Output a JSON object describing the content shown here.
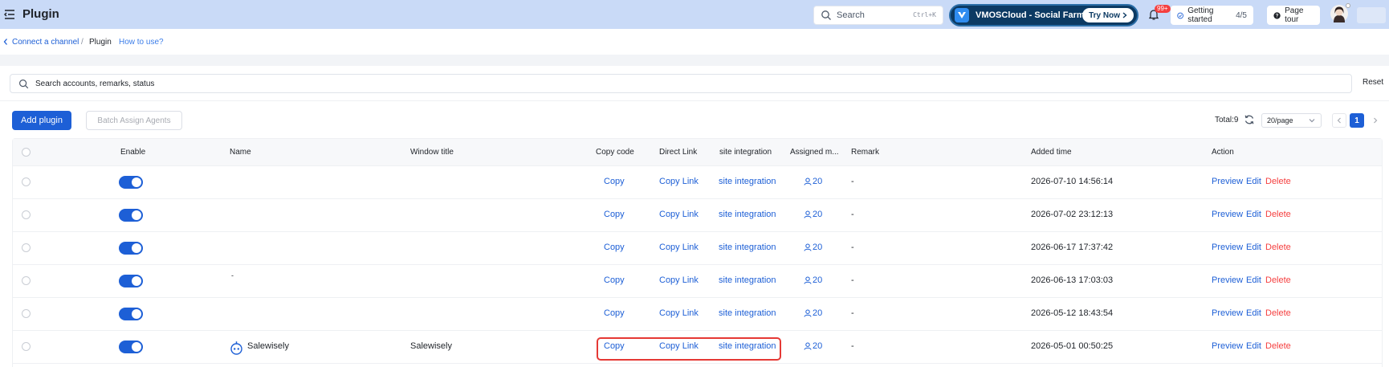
{
  "header": {
    "title": "Plugin",
    "search_placeholder": "Search",
    "search_shortcut": "Ctrl+K",
    "promo_text": "VMOSCloud - Social Farming",
    "promo_button": "Try Now",
    "notification_count": "99+",
    "getting_started_label": "Getting started",
    "getting_started_progress": "4/5",
    "page_tour_label": "Page tour"
  },
  "breadcrumb": {
    "back": "Connect a channel",
    "separator": "/",
    "current": "Plugin",
    "help": "How to use?"
  },
  "filter": {
    "placeholder": "Search accounts, remarks, status",
    "reset_label": "Reset"
  },
  "toolbar": {
    "add_label": "Add plugin",
    "batch_label": "Batch Assign Agents",
    "total_label": "Total:9",
    "page_size": "20/page",
    "current_page": "1"
  },
  "table": {
    "headers": {
      "enable": "Enable",
      "name": "Name",
      "window_title": "Window title",
      "copy_code": "Copy code",
      "direct_link": "Direct Link",
      "site_integration": "site integration",
      "assigned": "Assigned m...",
      "remark": "Remark",
      "added_time": "Added time",
      "action": "Action"
    },
    "rows": [
      {
        "name": "",
        "window_title": "",
        "copy": "Copy",
        "link": "Copy Link",
        "site": "site integration",
        "agents": "20",
        "remark": "-",
        "time": "2026-07-10 14:56:14",
        "preview": "Preview",
        "edit": "Edit",
        "delete": "Delete"
      },
      {
        "name": "",
        "window_title": "",
        "copy": "Copy",
        "link": "Copy Link",
        "site": "site integration",
        "agents": "20",
        "remark": "-",
        "time": "2026-07-02 23:12:13",
        "preview": "Preview",
        "edit": "Edit",
        "delete": "Delete"
      },
      {
        "name": "",
        "window_title": "",
        "copy": "Copy",
        "link": "Copy Link",
        "site": "site integration",
        "agents": "20",
        "remark": "-",
        "time": "2026-06-17 17:37:42",
        "preview": "Preview",
        "edit": "Edit",
        "delete": "Delete"
      },
      {
        "name": "-",
        "window_title": "",
        "copy": "Copy",
        "link": "Copy Link",
        "site": "site integration",
        "agents": "20",
        "remark": "-",
        "time": "2026-06-13 17:03:03",
        "preview": "Preview",
        "edit": "Edit",
        "delete": "Delete"
      },
      {
        "name": "",
        "window_title": "",
        "copy": "Copy",
        "link": "Copy Link",
        "site": "site integration",
        "agents": "20",
        "remark": "-",
        "time": "2026-05-12 18:43:54",
        "preview": "Preview",
        "edit": "Edit",
        "delete": "Delete"
      },
      {
        "name": "Salewisely",
        "window_title": "Salewisely",
        "copy": "Copy",
        "link": "Copy Link",
        "site": "site integration",
        "agents": "20",
        "remark": "-",
        "time": "2026-05-01 00:50:25",
        "preview": "Preview",
        "edit": "Edit",
        "delete": "Delete"
      }
    ]
  },
  "colors": {
    "accent": "#1d5fd6",
    "header_bg": "#c9daf7",
    "danger": "#f53f3f",
    "highlight": "#e53935"
  }
}
